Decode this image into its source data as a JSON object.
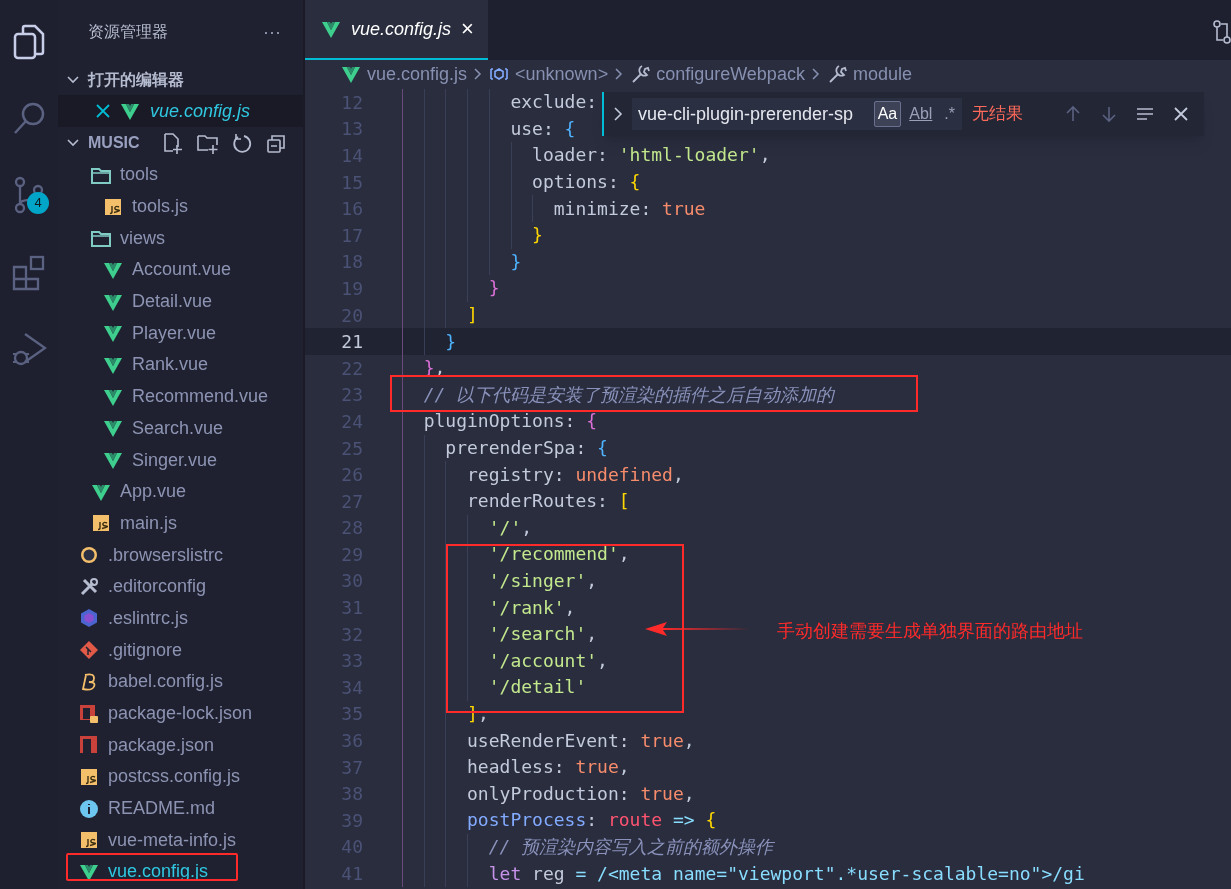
{
  "activity_bar": [
    {
      "kind": "files",
      "selected": true
    },
    {
      "kind": "search",
      "selected": false
    },
    {
      "kind": "source-control",
      "selected": false,
      "badge": "4"
    },
    {
      "kind": "extensions",
      "selected": false
    },
    {
      "kind": "run-debug",
      "selected": false
    }
  ],
  "sidebar": {
    "title": "资源管理器",
    "more": "···",
    "open_editors": {
      "title": "打开的编辑器",
      "expanded": true,
      "items": [
        {
          "name": "vue.config.js",
          "kind": "vue",
          "selected": true
        }
      ]
    },
    "folder": {
      "title": "MUSIC",
      "expanded": true,
      "tree": [
        {
          "kind": "hidden",
          "children": [
            {
              "name": "tools",
              "kind": "folder",
              "selected": false,
              "children": [
                {
                  "name": "tools.js",
                  "kind": "js",
                  "selected": false
                }
              ]
            },
            {
              "name": "views",
              "kind": "folder",
              "selected": false,
              "children": [
                {
                  "name": "Account.vue",
                  "kind": "vue",
                  "selected": false
                },
                {
                  "name": "Detail.vue",
                  "kind": "vue",
                  "selected": false
                },
                {
                  "name": "Player.vue",
                  "kind": "vue",
                  "selected": false
                },
                {
                  "name": "Rank.vue",
                  "kind": "vue",
                  "selected": false
                },
                {
                  "name": "Recommend.vue",
                  "kind": "vue",
                  "selected": false
                },
                {
                  "name": "Search.vue",
                  "kind": "vue",
                  "selected": false
                },
                {
                  "name": "Singer.vue",
                  "kind": "vue",
                  "selected": false
                }
              ]
            },
            {
              "name": "App.vue",
              "kind": "vue",
              "selected": false
            },
            {
              "name": "main.js",
              "kind": "js",
              "selected": false
            }
          ]
        },
        {
          "name": ".browserslistrc",
          "kind": "browserslist",
          "selected": false
        },
        {
          "name": ".editorconfig",
          "kind": "tools",
          "selected": false
        },
        {
          "name": ".eslintrc.js",
          "kind": "eslint",
          "selected": false
        },
        {
          "name": ".gitignore",
          "kind": "git",
          "selected": false
        },
        {
          "name": "babel.config.js",
          "kind": "babel",
          "selected": false
        },
        {
          "name": "package-lock.json",
          "kind": "npm-lock",
          "selected": false
        },
        {
          "name": "package.json",
          "kind": "npm",
          "selected": false
        },
        {
          "name": "postcss.config.js",
          "kind": "js",
          "selected": false
        },
        {
          "name": "README.md",
          "kind": "info",
          "selected": false
        },
        {
          "name": "vue-meta-info.js",
          "kind": "js",
          "selected": false
        },
        {
          "name": "vue.config.js",
          "kind": "vue",
          "selected": true
        }
      ]
    }
  },
  "tabs": [
    {
      "label": "vue.config.js",
      "kind": "vue",
      "selected": true,
      "close": "×"
    }
  ],
  "breadcrumb": [
    {
      "label": "vue.config.js",
      "kind": "vue"
    },
    {
      "label": "<unknown>",
      "kind": "module"
    },
    {
      "label": "configureWebpack",
      "kind": "wrench"
    },
    {
      "label": "module",
      "kind": "wrench"
    }
  ],
  "find_widget": {
    "query": "vue-cli-plugin-prerender-sp",
    "options": [
      {
        "label": "Aa",
        "on": true
      },
      {
        "label": "Abl",
        "on": false
      },
      {
        "label": ".*",
        "on": false
      }
    ],
    "result": "无结果"
  },
  "editor": {
    "lines": [
      {
        "number": "12",
        "current": false,
        "tokens": [
          {
            "kind": "key",
            "text": "          exclude:"
          }
        ]
      },
      {
        "number": "13",
        "current": false,
        "tokens": [
          {
            "kind": "key",
            "text": "          use: "
          },
          {
            "kind": "b3",
            "text": "{"
          }
        ]
      },
      {
        "number": "14",
        "current": false,
        "tokens": [
          {
            "kind": "key",
            "text": "            loader: "
          },
          {
            "kind": "string",
            "text": "'html-loader'"
          },
          {
            "kind": "key",
            "text": ","
          }
        ]
      },
      {
        "number": "15",
        "current": false,
        "tokens": [
          {
            "kind": "key",
            "text": "            options: "
          },
          {
            "kind": "b1",
            "text": "{"
          }
        ]
      },
      {
        "number": "16",
        "current": false,
        "tokens": [
          {
            "kind": "key",
            "text": "              minimize: "
          },
          {
            "kind": "literal",
            "text": "true"
          }
        ]
      },
      {
        "number": "17",
        "current": false,
        "tokens": [
          {
            "kind": "b1",
            "text": "            }"
          }
        ]
      },
      {
        "number": "18",
        "current": false,
        "tokens": [
          {
            "kind": "b3",
            "text": "          }"
          }
        ]
      },
      {
        "number": "19",
        "current": false,
        "tokens": [
          {
            "kind": "b2",
            "text": "        }"
          }
        ]
      },
      {
        "number": "20",
        "current": false,
        "tokens": [
          {
            "kind": "b1",
            "text": "      ]"
          }
        ]
      },
      {
        "number": "21",
        "current": true,
        "tokens": [
          {
            "kind": "b3",
            "text": "    }"
          }
        ]
      },
      {
        "number": "22",
        "current": false,
        "tokens": [
          {
            "kind": "b2",
            "text": "  }"
          },
          {
            "kind": "key",
            "text": ","
          }
        ]
      },
      {
        "number": "23",
        "current": false,
        "tokens": [
          {
            "kind": "comment",
            "text": "  // 以下代码是安装了预渲染的插件之后自动添加的"
          }
        ]
      },
      {
        "number": "24",
        "current": false,
        "tokens": [
          {
            "kind": "key",
            "text": "  pluginOptions: "
          },
          {
            "kind": "b2",
            "text": "{"
          }
        ]
      },
      {
        "number": "25",
        "current": false,
        "tokens": [
          {
            "kind": "key",
            "text": "    prerenderSpa: "
          },
          {
            "kind": "b3",
            "text": "{"
          }
        ]
      },
      {
        "number": "26",
        "current": false,
        "tokens": [
          {
            "kind": "key",
            "text": "      registry: "
          },
          {
            "kind": "literal",
            "text": "undefined"
          },
          {
            "kind": "key",
            "text": ","
          }
        ]
      },
      {
        "number": "27",
        "current": false,
        "tokens": [
          {
            "kind": "key",
            "text": "      renderRoutes: "
          },
          {
            "kind": "b1",
            "text": "["
          }
        ]
      },
      {
        "number": "28",
        "current": false,
        "tokens": [
          {
            "kind": "string",
            "text": "        '/'"
          },
          {
            "kind": "key",
            "text": ","
          }
        ]
      },
      {
        "number": "29",
        "current": false,
        "tokens": [
          {
            "kind": "string",
            "text": "        '/recommend'"
          },
          {
            "kind": "key",
            "text": ","
          }
        ]
      },
      {
        "number": "30",
        "current": false,
        "tokens": [
          {
            "kind": "string",
            "text": "        '/singer'"
          },
          {
            "kind": "key",
            "text": ","
          }
        ]
      },
      {
        "number": "31",
        "current": false,
        "tokens": [
          {
            "kind": "string",
            "text": "        '/rank'"
          },
          {
            "kind": "key",
            "text": ","
          }
        ]
      },
      {
        "number": "32",
        "current": false,
        "tokens": [
          {
            "kind": "string",
            "text": "        '/search'"
          },
          {
            "kind": "key",
            "text": ","
          }
        ]
      },
      {
        "number": "33",
        "current": false,
        "tokens": [
          {
            "kind": "string",
            "text": "        '/account'"
          },
          {
            "kind": "key",
            "text": ","
          }
        ]
      },
      {
        "number": "34",
        "current": false,
        "tokens": [
          {
            "kind": "string",
            "text": "        '/detail'"
          }
        ]
      },
      {
        "number": "35",
        "current": false,
        "tokens": [
          {
            "kind": "b1",
            "text": "      ]"
          },
          {
            "kind": "key",
            "text": ","
          }
        ]
      },
      {
        "number": "36",
        "current": false,
        "tokens": [
          {
            "kind": "key",
            "text": "      useRenderEvent: "
          },
          {
            "kind": "literal",
            "text": "true"
          },
          {
            "kind": "key",
            "text": ","
          }
        ]
      },
      {
        "number": "37",
        "current": false,
        "tokens": [
          {
            "kind": "key",
            "text": "      headless: "
          },
          {
            "kind": "literal",
            "text": "true"
          },
          {
            "kind": "key",
            "text": ","
          }
        ]
      },
      {
        "number": "38",
        "current": false,
        "tokens": [
          {
            "kind": "key",
            "text": "      onlyProduction: "
          },
          {
            "kind": "literal",
            "text": "true"
          },
          {
            "kind": "key",
            "text": ","
          }
        ]
      },
      {
        "number": "39",
        "current": false,
        "tokens": [
          {
            "kind": "func",
            "text": "      postProcess"
          },
          {
            "kind": "key",
            "text": ": "
          },
          {
            "kind": "param",
            "text": "route"
          },
          {
            "kind": "op",
            "text": " => "
          },
          {
            "kind": "b1",
            "text": "{"
          }
        ]
      },
      {
        "number": "40",
        "current": false,
        "tokens": [
          {
            "kind": "comment",
            "text": "        // 预渲染内容写入之前的额外操作"
          }
        ]
      },
      {
        "number": "41",
        "current": false,
        "tokens": [
          {
            "kind": "keyword",
            "text": "        let "
          },
          {
            "kind": "key",
            "text": "reg "
          },
          {
            "kind": "op",
            "text": "= "
          },
          {
            "kind": "regex",
            "text": "/<meta name=\"viewport\".*user-scalable=no\">/gi"
          }
        ]
      }
    ]
  },
  "annotation": {
    "text": "手动创建需要生成单独界面的路由地址"
  }
}
